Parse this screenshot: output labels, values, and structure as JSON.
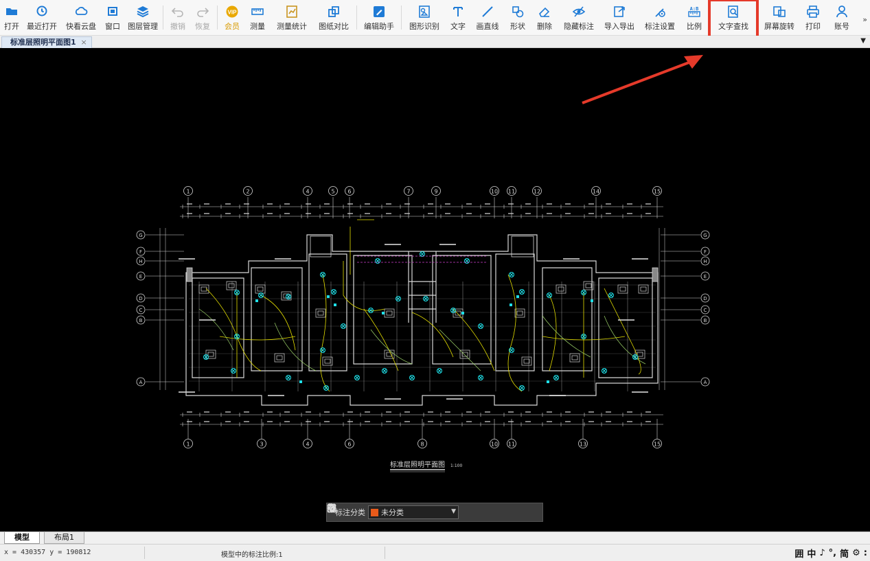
{
  "toolbar": {
    "items": [
      {
        "name": "open-button",
        "icon": "folder-open-icon",
        "label": "打开",
        "enabled": true
      },
      {
        "name": "recent-button",
        "icon": "history-icon",
        "label": "最近打开",
        "enabled": true
      },
      {
        "name": "cloud-button",
        "icon": "cloud-icon",
        "label": "快看云盘",
        "enabled": true
      },
      {
        "name": "window-button",
        "icon": "window-icon",
        "label": "窗口",
        "enabled": true
      },
      {
        "name": "layer-button",
        "icon": "layers-icon",
        "label": "图层管理",
        "enabled": true
      },
      {
        "name": "undo-button",
        "icon": "undo-icon",
        "label": "撤销",
        "enabled": false
      },
      {
        "name": "redo-button",
        "icon": "redo-icon",
        "label": "恢复",
        "enabled": false
      },
      {
        "name": "vip-button",
        "icon": "vip-icon",
        "label": "会员",
        "enabled": true,
        "accent": "#d89a00"
      },
      {
        "name": "measure-button",
        "icon": "ruler-icon",
        "label": "测量",
        "enabled": true
      },
      {
        "name": "measure-stats-button",
        "icon": "measure-stats-icon",
        "label": "测量统计",
        "enabled": true
      },
      {
        "name": "compare-button",
        "icon": "compare-icon",
        "label": "图纸对比",
        "enabled": true
      },
      {
        "name": "edit-assistant-button",
        "icon": "edit-assistant-icon",
        "label": "编辑助手",
        "enabled": true
      },
      {
        "name": "shape-recognize-button",
        "icon": "shape-recognize-icon",
        "label": "图形识别",
        "enabled": true
      },
      {
        "name": "text-button",
        "icon": "text-icon",
        "label": "文字",
        "enabled": true
      },
      {
        "name": "line-button",
        "icon": "line-icon",
        "label": "画直线",
        "enabled": true
      },
      {
        "name": "shape-button",
        "icon": "shape-icon",
        "label": "形状",
        "enabled": true
      },
      {
        "name": "delete-button",
        "icon": "eraser-icon",
        "label": "删除",
        "enabled": true
      },
      {
        "name": "hide-annotation-button",
        "icon": "eye-off-icon",
        "label": "隐藏标注",
        "enabled": true
      },
      {
        "name": "import-export-button",
        "icon": "import-export-icon",
        "label": "导入导出",
        "enabled": true
      },
      {
        "name": "annotation-settings-button",
        "icon": "settings-icon",
        "label": "标注设置",
        "enabled": true
      },
      {
        "name": "scale-button",
        "icon": "scale-icon",
        "label": "比例",
        "enabled": true
      },
      {
        "name": "text-search-button",
        "icon": "text-search-icon",
        "label": "文字查找",
        "enabled": true,
        "highlighted": true
      },
      {
        "name": "screen-rotate-button",
        "icon": "rotate-icon",
        "label": "屏幕旋转",
        "enabled": true
      },
      {
        "name": "print-button",
        "icon": "printer-icon",
        "label": "打印",
        "enabled": true
      },
      {
        "name": "account-button",
        "icon": "user-icon",
        "label": "账号",
        "enabled": true
      }
    ],
    "more": "»"
  },
  "document_tab": {
    "label": "标准层照明平面图1",
    "close": "×"
  },
  "drawing": {
    "title": "标准层照明平面图",
    "scale_label": "1:100",
    "top_axis_labels": [
      "1",
      "2",
      "4",
      "5",
      "6",
      "7",
      "9",
      "10",
      "11",
      "12",
      "14",
      "15"
    ],
    "bottom_axis_labels": [
      "1",
      "3",
      "4",
      "6",
      "8",
      "10",
      "11",
      "13",
      "15"
    ],
    "left_axis_labels": [
      "G",
      "F",
      "H",
      "E",
      "D",
      "C",
      "B",
      "A"
    ],
    "right_axis_labels": [
      "G",
      "F",
      "H",
      "E",
      "D",
      "C",
      "B",
      "A"
    ],
    "annotation_color": "#e53a2a"
  },
  "annotation_bar": {
    "category_label": "标注分类",
    "selected": "未分类",
    "swatch_color": "#e85a1a"
  },
  "layout_tabs": {
    "model": "模型",
    "layout1": "布局1"
  },
  "status": {
    "coords": "x = 430357 y = 190812",
    "scale_text": "模型中的标注比例:1"
  },
  "ime": {
    "items": [
      "囲",
      "中",
      "♪",
      "°,",
      "简",
      "⚙",
      ":"
    ]
  }
}
